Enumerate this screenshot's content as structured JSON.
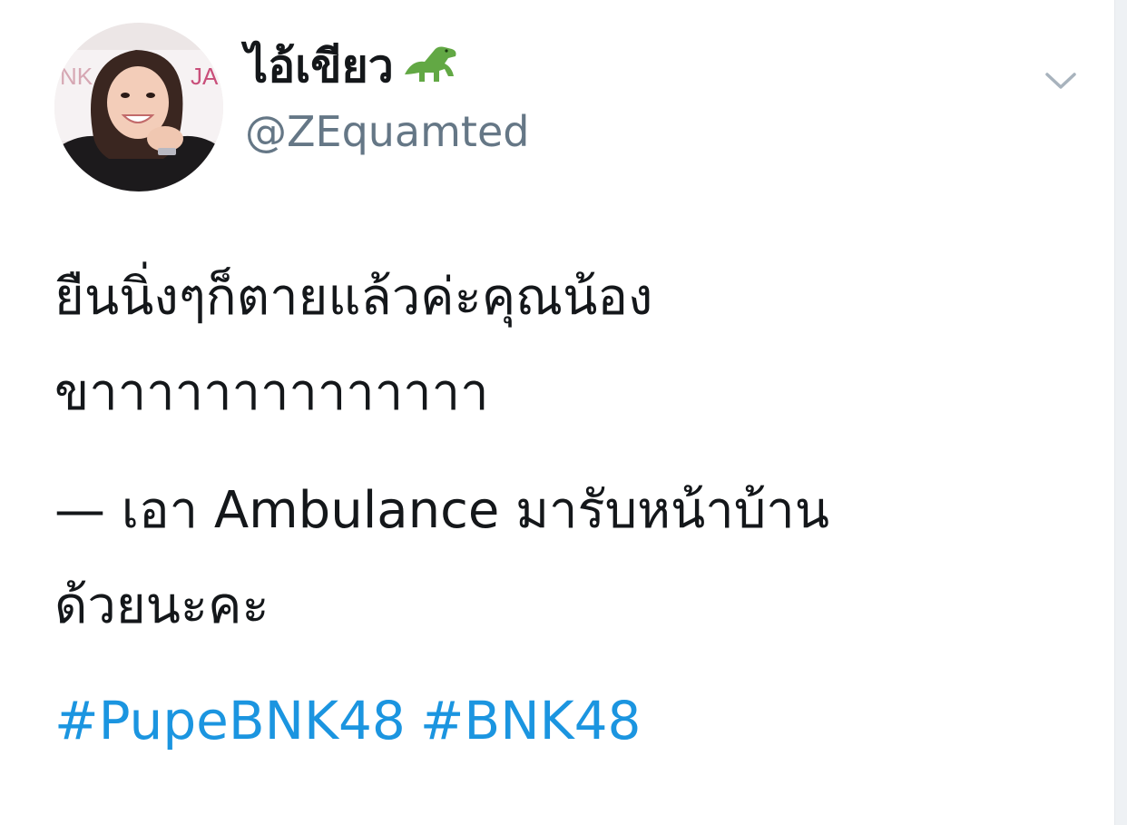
{
  "tweet": {
    "author": {
      "display_name": "ไอ้เขียว",
      "name_emoji": "t-rex-emoji",
      "handle": "@ZEquamted",
      "avatar_icon": "profile-photo"
    },
    "caret_icon": "chevron-down-icon",
    "text_lines": [
      "ยืนนิ่งๆก็ตายแล้วค่ะคุณน้อง",
      "ขาาาาาาาาาาาาาา",
      "— เอา Ambulance มารับหน้าบ้าน",
      "ด้วยนะคะ"
    ],
    "hashtags": [
      "#PupeBNK48",
      "#BNK48"
    ]
  },
  "colors": {
    "text": "#14171a",
    "secondary": "#657786",
    "link": "#1b95e0",
    "background": "#ffffff"
  }
}
